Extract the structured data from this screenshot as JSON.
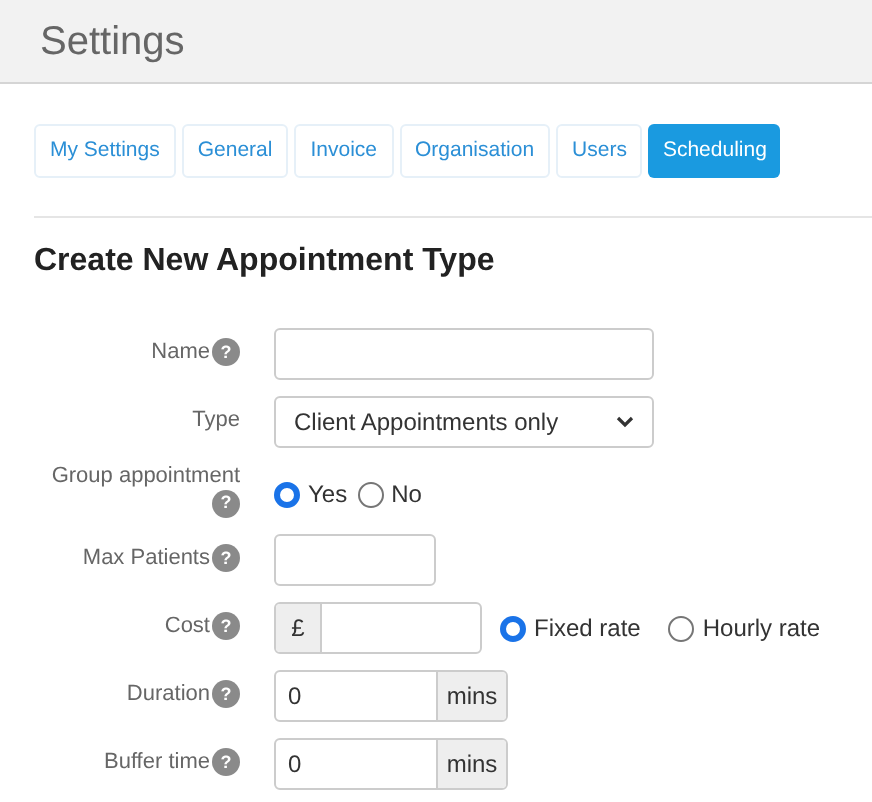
{
  "header": {
    "title": "Settings"
  },
  "tabs": [
    {
      "label": "My Settings",
      "selected": false
    },
    {
      "label": "General",
      "selected": false
    },
    {
      "label": "Invoice",
      "selected": false
    },
    {
      "label": "Organisation",
      "selected": false
    },
    {
      "label": "Users",
      "selected": false
    },
    {
      "label": "Scheduling",
      "selected": true
    }
  ],
  "form": {
    "title": "Create New Appointment Type",
    "fields": [
      {
        "kind": "text",
        "label": "Name",
        "help": "?"
      },
      {
        "kind": "select",
        "label": "Type",
        "value": "Client Appointments only"
      },
      {
        "kind": "radio",
        "label": "Group appointment",
        "help": "?",
        "options": [
          {
            "label": "Yes",
            "selected": true
          },
          {
            "label": "No",
            "selected": false
          }
        ]
      },
      {
        "kind": "short",
        "label": "Max Patients",
        "help": "?"
      },
      {
        "kind": "currency",
        "label": "Cost",
        "help": "?",
        "prefix": "£",
        "options": [
          {
            "label": "Fixed rate",
            "selected": true
          },
          {
            "label": "Hourly rate",
            "selected": false
          }
        ]
      },
      {
        "kind": "suffix",
        "label": "Duration",
        "help": "?",
        "value": "0",
        "suffix": "mins"
      },
      {
        "kind": "suffix",
        "label": "Buffer time",
        "help": "?",
        "value": "0",
        "suffix": "mins"
      }
    ]
  }
}
